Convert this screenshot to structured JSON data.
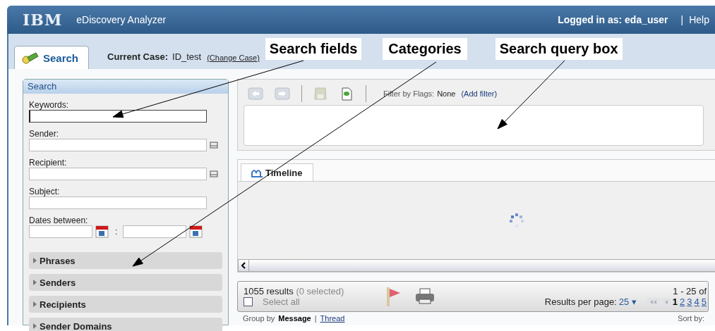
{
  "header": {
    "logo": "IBM",
    "app_title": "eDiscovery Analyzer",
    "user": "Logged in as: eda_user",
    "separator": "|",
    "help": "Help"
  },
  "tabs": [
    {
      "label": "Search",
      "selected": true
    }
  ],
  "case": {
    "label": "Current Case:",
    "value": "ID_test",
    "link": "(Change Case)"
  },
  "callouts": [
    {
      "text": "Search fields"
    },
    {
      "text": "Categories"
    },
    {
      "text": "Search query box"
    }
  ],
  "search_panel": {
    "title": "Search",
    "fields": [
      {
        "label": "Keywords:",
        "kind": "text",
        "focused": true
      },
      {
        "label": "Sender:",
        "kind": "picker",
        "focused": false
      },
      {
        "label": "Recipient:",
        "kind": "picker",
        "focused": false
      },
      {
        "label": "Subject:",
        "kind": "text",
        "focused": false
      },
      {
        "label": "Dates between:",
        "kind": "date_range",
        "separator": ":",
        "focused": false
      }
    ],
    "categories": [
      {
        "label": "Phrases",
        "expanded": false
      },
      {
        "label": "Senders",
        "expanded": false
      },
      {
        "label": "Recipients",
        "expanded": false
      },
      {
        "label": "Sender Domains",
        "expanded": false
      }
    ]
  },
  "toolbar": {
    "filter_label": "Filter by Flags:",
    "filter_value": "None",
    "add_filter": "(Add filter)"
  },
  "timeline_tabs": [
    {
      "label": "Timeline",
      "selected": true
    }
  ],
  "results": {
    "count": "1055 results",
    "selected_count": "(0 selected)",
    "select_all": {
      "label": "Select all",
      "checked": false
    },
    "range": "1 - 25 of",
    "per_page_label": "Results per page:",
    "per_page": "25",
    "per_page_caret": "▾",
    "pages": [
      {
        "label": "1",
        "selected": true
      },
      {
        "label": "2",
        "selected": false
      },
      {
        "label": "3",
        "selected": false
      },
      {
        "label": "4",
        "selected": false
      },
      {
        "label": "5",
        "selected": false
      }
    ]
  },
  "group_by": {
    "label": "Group by",
    "options": [
      {
        "label": "Message",
        "selected": true
      },
      {
        "label": "Thread",
        "selected": false
      }
    ],
    "separator": "|",
    "sort_label": "Sort by:"
  }
}
